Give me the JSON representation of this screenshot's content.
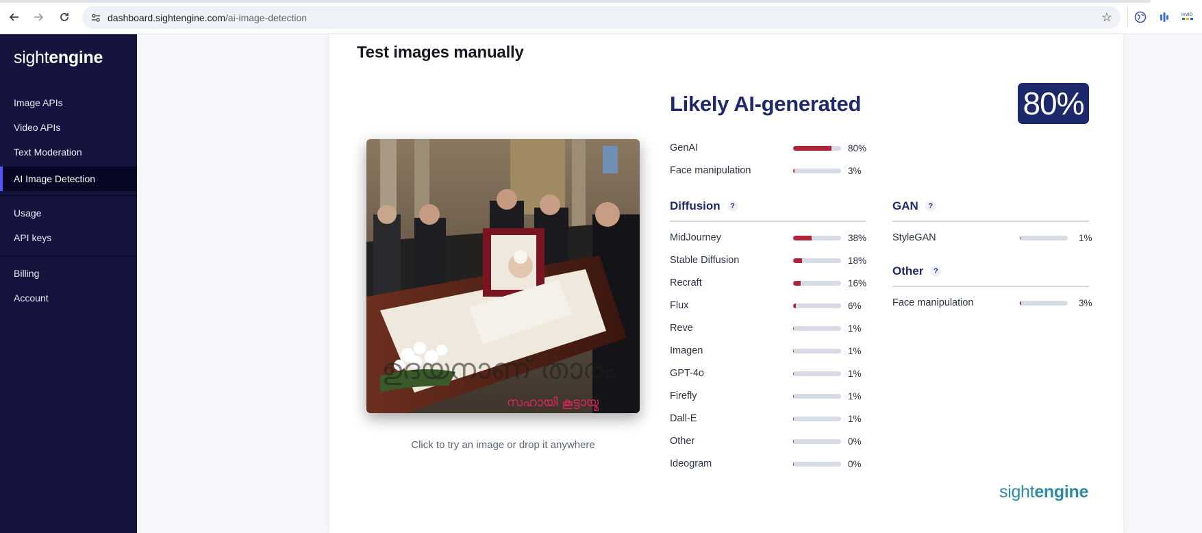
{
  "browser": {
    "url_host": "dashboard.sightengine.com",
    "url_path": "/ai-image-detection",
    "icons": [
      "back-icon",
      "forward-icon",
      "reload-icon",
      "site-info-icon",
      "star-icon"
    ],
    "extensions": [
      "globe-icon",
      "bars-icon",
      "invid-icon"
    ]
  },
  "sidebar": {
    "brand_light": "sight",
    "brand_bold": "engine",
    "items": [
      {
        "label": "Image APIs"
      },
      {
        "label": "Video APIs"
      },
      {
        "label": "Text Moderation"
      },
      {
        "label": "AI Image Detection"
      },
      {
        "label": "Usage"
      },
      {
        "label": "API keys"
      },
      {
        "label": "Billing"
      },
      {
        "label": "Account"
      }
    ]
  },
  "main": {
    "title": "Test images manually",
    "hint": "Click to try an image or drop it anywhere",
    "verdict": "Likely AI-generated",
    "score": "80%",
    "top_results": [
      {
        "label": "GenAI",
        "pct_text": "80%",
        "value": 80
      },
      {
        "label": "Face manipulation",
        "pct_text": "3%",
        "value": 3
      }
    ],
    "diffusion": {
      "title": "Diffusion",
      "help": "?",
      "items": [
        {
          "label": "MidJourney",
          "pct_text": "38%",
          "value": 38
        },
        {
          "label": "Stable Diffusion",
          "pct_text": "18%",
          "value": 18
        },
        {
          "label": "Recraft",
          "pct_text": "16%",
          "value": 16
        },
        {
          "label": "Flux",
          "pct_text": "6%",
          "value": 6
        },
        {
          "label": "Reve",
          "pct_text": "1%",
          "value": 1
        },
        {
          "label": "Imagen",
          "pct_text": "1%",
          "value": 1
        },
        {
          "label": "GPT-4o",
          "pct_text": "1%",
          "value": 1
        },
        {
          "label": "Firefly",
          "pct_text": "1%",
          "value": 1
        },
        {
          "label": "Dall-E",
          "pct_text": "1%",
          "value": 1
        },
        {
          "label": "Other",
          "pct_text": "0%",
          "value": 0
        },
        {
          "label": "Ideogram",
          "pct_text": "0%",
          "value": 0
        }
      ]
    },
    "gan": {
      "title": "GAN",
      "help": "?",
      "items": [
        {
          "label": "StyleGAN",
          "pct_text": "1%",
          "value": 1
        }
      ]
    },
    "other": {
      "title": "Other",
      "help": "?",
      "items": [
        {
          "label": "Face manipulation",
          "pct_text": "3%",
          "value": 3
        }
      ]
    },
    "footer_brand_light": "sight",
    "footer_brand_bold": "engine"
  },
  "colors": {
    "sidebar_bg": "#14143f",
    "accent_navy": "#1f2a6b",
    "bar_fill": "#b0243a",
    "bar_track": "#d6dbe6",
    "footer_brand": "#2f8aa5"
  }
}
